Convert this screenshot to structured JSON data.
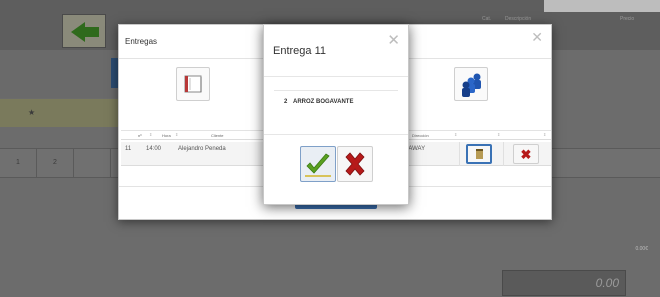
{
  "background": {
    "top_labels": [
      "Cat.",
      "Descripción",
      "Precio"
    ],
    "row_cells": [
      "1",
      "2"
    ],
    "total_label": "0.00€",
    "amount_display": "0.00"
  },
  "entregas_modal": {
    "title": "Entregas",
    "close_icon": "close-x-icon",
    "columns": [
      "nº",
      "Hora",
      "Cliente",
      "Dirección"
    ],
    "rows": [
      {
        "number": "11",
        "time": "14:00",
        "client": "Alejandro Peneda",
        "address": "KE AWAY"
      }
    ]
  },
  "entrega_dialog": {
    "title": "Entrega 11",
    "items": [
      {
        "qty": "2",
        "name": "ARROZ BOGAVANTE"
      }
    ]
  },
  "colors": {
    "accent_blue": "#3a6fb0",
    "confirm_green": "#5aa020",
    "cancel_red": "#b61a1a",
    "users_blue": "#1f55b0"
  }
}
